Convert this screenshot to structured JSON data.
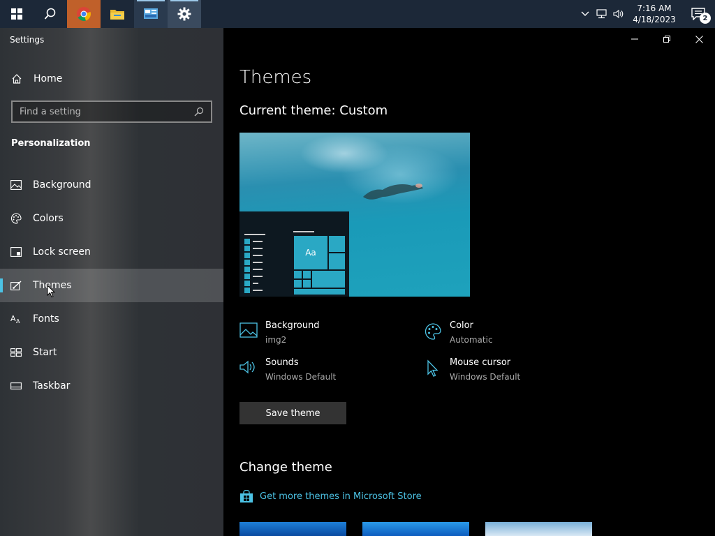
{
  "taskbar": {
    "apps": [
      {
        "name": "start",
        "icon": "windows-logo-icon"
      },
      {
        "name": "search",
        "icon": "search-icon"
      },
      {
        "name": "chrome",
        "icon": "chrome-icon"
      },
      {
        "name": "file-explorer",
        "icon": "folder-icon"
      },
      {
        "name": "control-panel",
        "icon": "control-panel-icon"
      },
      {
        "name": "settings",
        "icon": "gear-icon"
      }
    ],
    "clock": {
      "time": "7:16 AM",
      "date": "4/18/2023"
    },
    "notification_count": "2"
  },
  "sidebar": {
    "app_title": "Settings",
    "home_label": "Home",
    "search_placeholder": "Find a setting",
    "section_heading": "Personalization",
    "items": [
      {
        "label": "Background",
        "icon": "picture-icon"
      },
      {
        "label": "Colors",
        "icon": "palette-icon"
      },
      {
        "label": "Lock screen",
        "icon": "lock-screen-icon"
      },
      {
        "label": "Themes",
        "icon": "themes-icon",
        "selected": true
      },
      {
        "label": "Fonts",
        "icon": "fonts-icon"
      },
      {
        "label": "Start",
        "icon": "start-icon"
      },
      {
        "label": "Taskbar",
        "icon": "taskbar-icon"
      }
    ]
  },
  "main": {
    "title": "Themes",
    "current_theme": "Current theme: Custom",
    "preview_tile_text": "Aa",
    "properties": {
      "background": {
        "name": "Background",
        "value": "img2"
      },
      "color": {
        "name": "Color",
        "value": "Automatic"
      },
      "sounds": {
        "name": "Sounds",
        "value": "Windows Default"
      },
      "mouse_cursor": {
        "name": "Mouse cursor",
        "value": "Windows Default"
      }
    },
    "save_label": "Save theme",
    "change_theme_title": "Change theme",
    "store_link": "Get more themes in Microsoft Store"
  },
  "colors": {
    "accent": "#4cc2e4",
    "taskbar": "#1c2838",
    "main_bg": "#000000"
  }
}
